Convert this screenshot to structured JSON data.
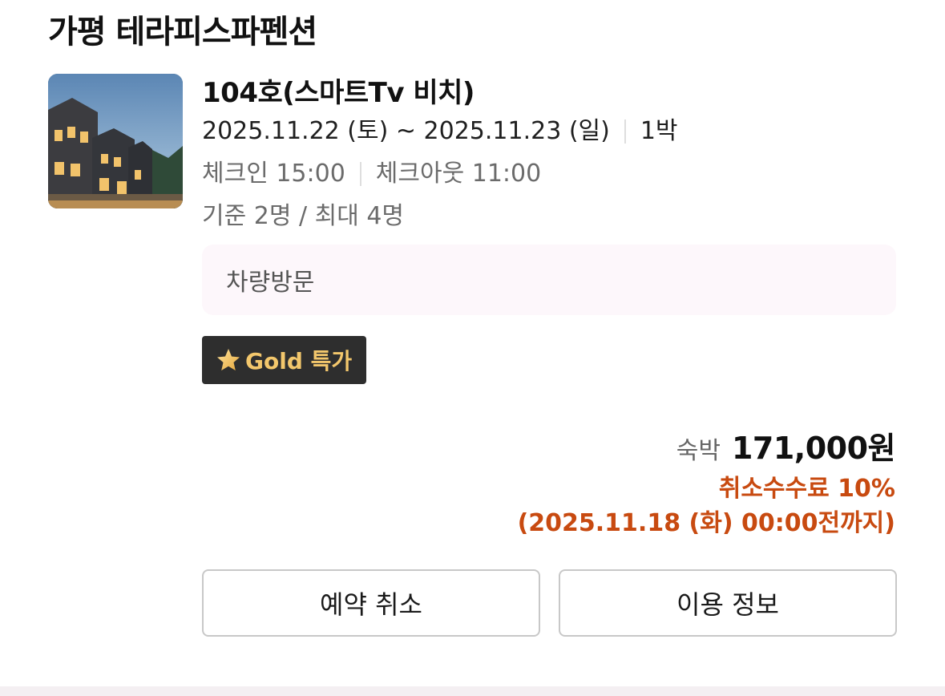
{
  "property": {
    "name": "가평 테라피스파펜션"
  },
  "room": {
    "name": "104호(스마트Tv 비치)",
    "dates": "2025.11.22 (토) ~ 2025.11.23 (일)",
    "nights": "1박",
    "checkin": "체크인 15:00",
    "checkout": "체크아웃 11:00",
    "occupancy": "기준 2명 / 최대 4명"
  },
  "visit_method": "차량방문",
  "badge": {
    "label": "Gold 특가",
    "icon": "star-icon",
    "text_color": "#f3c76c",
    "bg_color": "#2e2e2e"
  },
  "price": {
    "label": "숙박",
    "value": "171,000원"
  },
  "cancellation": {
    "fee": "취소수수료 10%",
    "deadline": "(2025.11.18 (화) 00:00전까지)",
    "color": "#c84a10"
  },
  "buttons": {
    "cancel": "예약 취소",
    "info": "이용 정보"
  }
}
